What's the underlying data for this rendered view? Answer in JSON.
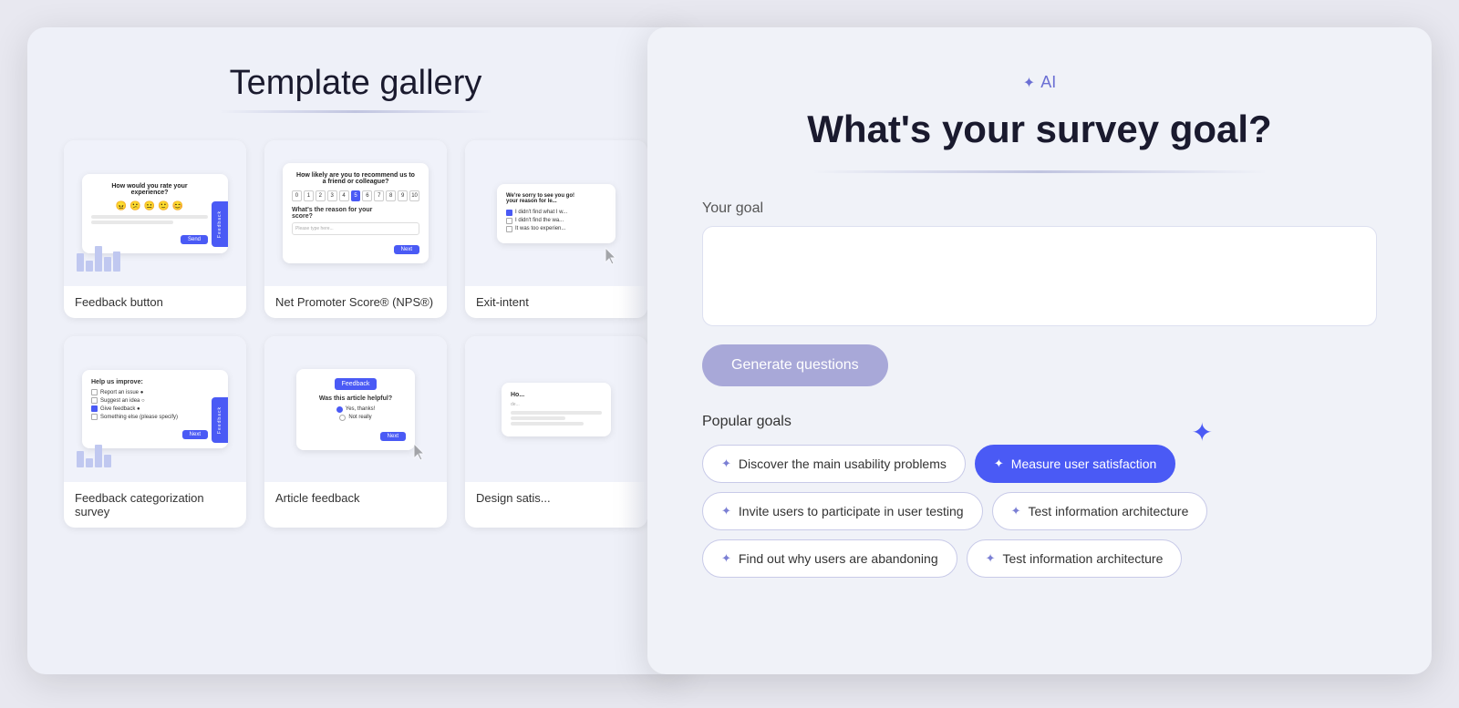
{
  "gallery": {
    "title": "Template gallery",
    "cards": [
      {
        "id": "feedback-button",
        "label": "Feedback button"
      },
      {
        "id": "nps",
        "label": "Net Promoter Score® (NPS®)"
      },
      {
        "id": "exit-intent",
        "label": "Exit-intent"
      },
      {
        "id": "feedback-categorization",
        "label": "Feedback categorization survey"
      },
      {
        "id": "article-feedback",
        "label": "Article feedback"
      },
      {
        "id": "design-satisfaction",
        "label": "Design satis..."
      }
    ]
  },
  "ai_panel": {
    "badge": "✦ AI",
    "heading": "What's your survey goal?",
    "goal_label": "Your goal",
    "goal_placeholder": "",
    "generate_button": "Generate questions",
    "popular_goals_label": "Popular goals",
    "goals": [
      {
        "id": "usability",
        "label": "Discover the main usability problems",
        "active": false
      },
      {
        "id": "satisfaction",
        "label": "Measure user satisfaction",
        "active": true
      },
      {
        "id": "invite-testing",
        "label": "Invite users to participate in user testing",
        "active": false
      },
      {
        "id": "test-ia-1",
        "label": "Test information architecture",
        "active": false
      },
      {
        "id": "abandoning",
        "label": "Find out why users are abandoning",
        "active": false
      },
      {
        "id": "test-ia-2",
        "label": "Test information architecture",
        "active": false
      }
    ]
  }
}
